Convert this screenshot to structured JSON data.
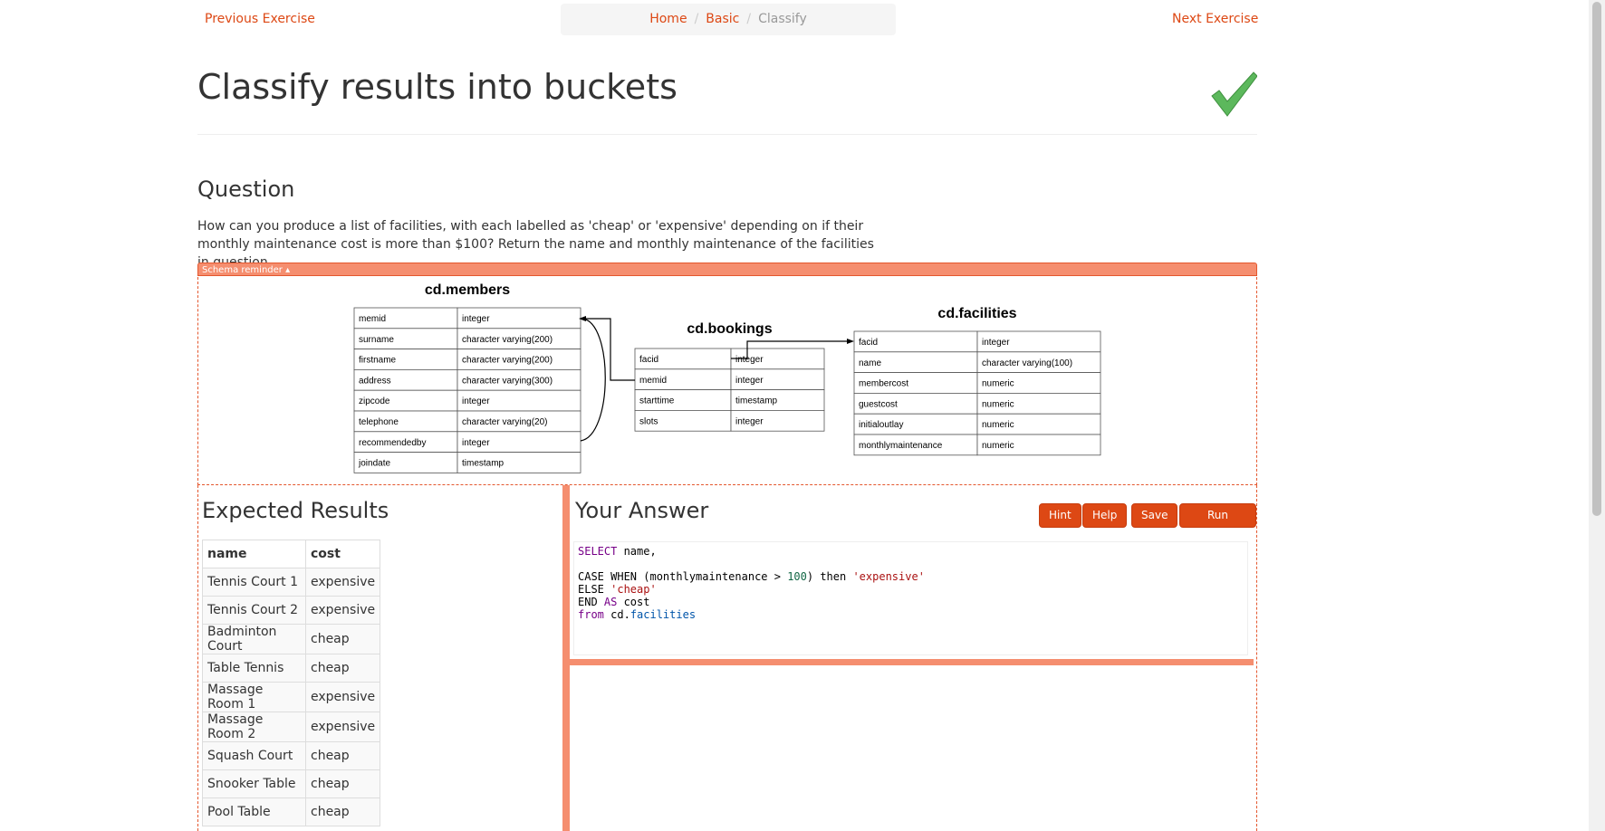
{
  "nav": {
    "previous": "Previous Exercise",
    "next": "Next Exercise",
    "breadcrumb": [
      {
        "label": "Home"
      },
      {
        "label": "Basic"
      },
      {
        "label": "Classify"
      }
    ]
  },
  "page": {
    "title": "Classify results into buckets",
    "status_icon": "checkmark-icon"
  },
  "question": {
    "heading": "Question",
    "text": "How can you produce a list of facilities, with each labelled as 'cheap' or 'expensive' depending on if their monthly maintenance cost is more than $100? Return the name and monthly maintenance of the facilities in question."
  },
  "schema": {
    "toggle_label": "Schema reminder ▴",
    "tables": [
      {
        "name": "cd.members",
        "columns": [
          [
            "memid",
            "integer"
          ],
          [
            "surname",
            "character varying(200)"
          ],
          [
            "firstname",
            "character varying(200)"
          ],
          [
            "address",
            "character varying(300)"
          ],
          [
            "zipcode",
            "integer"
          ],
          [
            "telephone",
            "character varying(20)"
          ],
          [
            "recommendedby",
            "integer"
          ],
          [
            "joindate",
            "timestamp"
          ]
        ]
      },
      {
        "name": "cd.bookings",
        "columns": [
          [
            "facid",
            "integer"
          ],
          [
            "memid",
            "integer"
          ],
          [
            "starttime",
            "timestamp"
          ],
          [
            "slots",
            "integer"
          ]
        ]
      },
      {
        "name": "cd.facilities",
        "columns": [
          [
            "facid",
            "integer"
          ],
          [
            "name",
            "character varying(100)"
          ],
          [
            "membercost",
            "numeric"
          ],
          [
            "guestcost",
            "numeric"
          ],
          [
            "initialoutlay",
            "numeric"
          ],
          [
            "monthlymaintenance",
            "numeric"
          ]
        ]
      }
    ]
  },
  "expected": {
    "heading": "Expected Results",
    "columns": [
      "name",
      "cost"
    ],
    "rows": [
      [
        "Tennis Court 1",
        "expensive"
      ],
      [
        "Tennis Court 2",
        "expensive"
      ],
      [
        "Badminton Court",
        "cheap"
      ],
      [
        "Table Tennis",
        "cheap"
      ],
      [
        "Massage Room 1",
        "expensive"
      ],
      [
        "Massage Room 2",
        "expensive"
      ],
      [
        "Squash Court",
        "cheap"
      ],
      [
        "Snooker Table",
        "cheap"
      ],
      [
        "Pool Table",
        "cheap"
      ]
    ]
  },
  "answer": {
    "heading": "Your Answer",
    "buttons": {
      "hint": "Hint",
      "help": "Help",
      "save": "Save",
      "run": "Run Query"
    },
    "code": {
      "l1_kw": "SELECT",
      "l1_rest": " name,",
      "l3_a": "CASE WHEN (monthlymaintenance > ",
      "l3_num": "100",
      "l3_b": ") then ",
      "l3_str": "'expensive'",
      "l4_a": "ELSE ",
      "l4_str": "'cheap'",
      "l5_a": "END ",
      "l5_kw": "AS",
      "l5_b": " cost",
      "l6_kw": "from",
      "l6_a": " cd.",
      "l6_var": "facilities"
    }
  },
  "colors": {
    "accent": "#dd4814",
    "schema_bar": "#f58e6f",
    "check": "#5cb85c"
  }
}
